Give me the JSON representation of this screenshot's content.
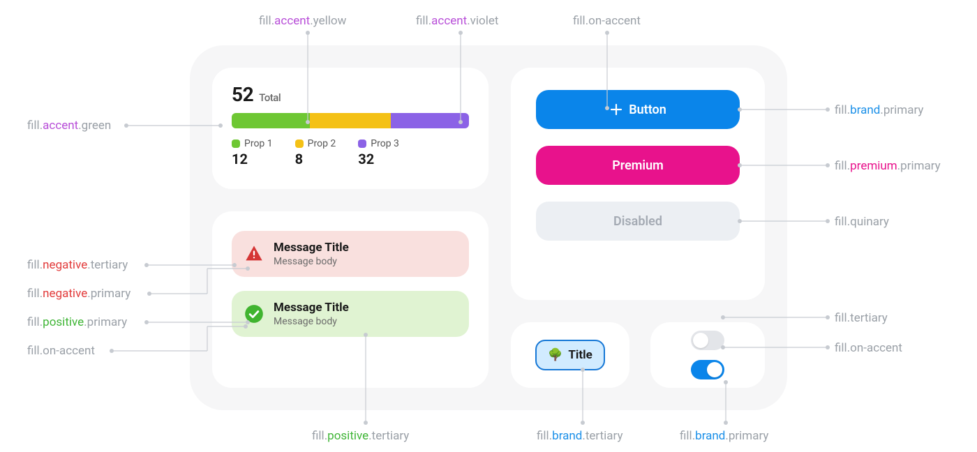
{
  "stats": {
    "total": "52",
    "total_label": "Total",
    "segments": [
      {
        "label": "Prop 1",
        "value": "12",
        "color_key": "accent-green"
      },
      {
        "label": "Prop 2",
        "value": "8",
        "color_key": "accent-yellow"
      },
      {
        "label": "Prop 3",
        "value": "32",
        "color_key": "accent-violet"
      }
    ]
  },
  "messages": [
    {
      "title": "Message Title",
      "body": "Message body",
      "tone": "negative"
    },
    {
      "title": "Message Title",
      "body": "Message body",
      "tone": "positive"
    }
  ],
  "buttons": {
    "primary_label": "Button",
    "premium_label": "Premium",
    "disabled_label": "Disabled"
  },
  "chip": {
    "emoji": "🌳",
    "label": "Title"
  },
  "toggles": {
    "off": false,
    "on": true
  },
  "annotations": {
    "top": [
      {
        "parts": [
          "fill.",
          "accent",
          ".yellow"
        ],
        "color": "accent"
      },
      {
        "parts": [
          "fill.",
          "accent",
          ".violet"
        ],
        "color": "accent"
      },
      {
        "parts": [
          "fill.",
          "on-accent"
        ],
        "color": "plain"
      }
    ],
    "left": [
      {
        "parts": [
          "fill.",
          "accent",
          ".green"
        ],
        "color": "accent"
      },
      {
        "parts": [
          "fill.",
          "negative",
          ".tertiary"
        ],
        "color": "negative"
      },
      {
        "parts": [
          "fill.",
          "negative",
          ".primary"
        ],
        "color": "negative"
      },
      {
        "parts": [
          "fill.",
          "positive",
          ".primary"
        ],
        "color": "positive"
      },
      {
        "parts": [
          "fill.",
          "on-accent"
        ],
        "color": "plain"
      }
    ],
    "right": [
      {
        "parts": [
          "fill.",
          "brand",
          ".primary"
        ],
        "color": "brand"
      },
      {
        "parts": [
          "fill.",
          "premium",
          ".primary"
        ],
        "color": "premium"
      },
      {
        "parts": [
          "fill.",
          "quinary"
        ],
        "color": "plain"
      },
      {
        "parts": [
          "fill.",
          "tertiary"
        ],
        "color": "plain"
      },
      {
        "parts": [
          "fill.",
          "on-accent"
        ],
        "color": "plain"
      }
    ],
    "bottom": [
      {
        "parts": [
          "fill.",
          "positive",
          ".tertiary"
        ],
        "color": "positive"
      },
      {
        "parts": [
          "fill.",
          "brand",
          ".tertiary"
        ],
        "color": "brand"
      },
      {
        "parts": [
          "fill.",
          "brand",
          ".primary"
        ],
        "color": "brand"
      }
    ]
  },
  "colors": {
    "accent-green": "#6ec733",
    "accent-yellow": "#f4c115",
    "accent-violet": "#8b62e6",
    "brand-primary": "#0a85ea",
    "brand-tertiary": "#d1ebff",
    "premium-primary": "#e8128c",
    "quinary": "#eceff3",
    "negative-primary": "#d53636",
    "negative-tertiary": "#f9e0de",
    "positive-primary": "#40b42f",
    "positive-tertiary": "#e0f3d2",
    "tertiary": "#e3e5e9",
    "on-accent": "#ffffff"
  }
}
